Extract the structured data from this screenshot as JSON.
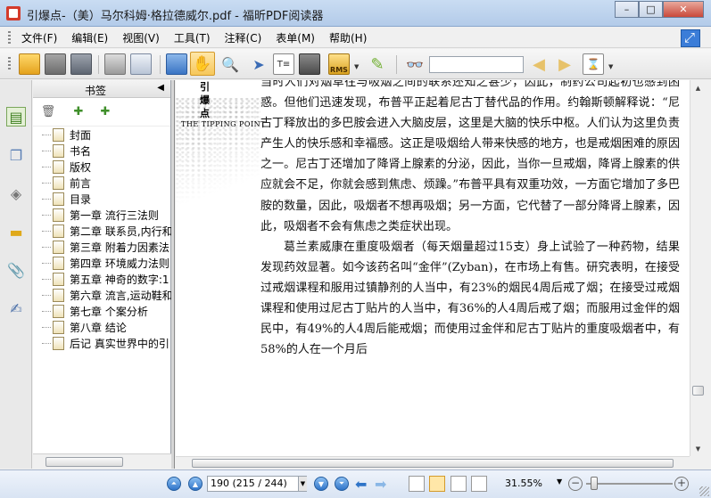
{
  "window": {
    "title": "引爆点-（美）马尔科姆·格拉德威尔.pdf - 福昕PDF阅读器",
    "minimize": "–",
    "maximize": "□",
    "close": "✕"
  },
  "menu": {
    "items": [
      "文件(F)",
      "编辑(E)",
      "视图(V)",
      "工具(T)",
      "注释(C)",
      "表单(M)",
      "帮助(H)"
    ]
  },
  "toolbar": {
    "search_value": "",
    "rms_label": "RMS"
  },
  "bookmarks": {
    "header": "书签",
    "items": [
      "封面",
      "书名",
      "版权",
      "前言",
      "目录",
      "第一章 流行三法则",
      "第二章 联系员,内行和",
      "第三章 附着力因素法",
      "第四章 环境威力法则",
      "第五章 神奇的数字:1",
      "第六章 流言,运动鞋和",
      "第七章 个案分析",
      "第八章 结论",
      "后记 真实世界中的引"
    ]
  },
  "page": {
    "deco_title_chars": [
      "引",
      "爆",
      "点"
    ],
    "deco_subtitle": "THE TIPPING POINT",
    "paragraph1": "当时人们对烟草往与吸烟之间的联系还知之甚少，因此，制药公司起初也感到困惑。但他们迅速发现，布普平正起着尼古丁替代品的作用。约翰斯顿解释说：“尼古丁释放出的多巴胺会进入大脑皮层，这里是大脑的快乐中枢。人们认为这里负责产生人的快乐感和幸福感。这正是吸烟给人带来快感的地方，也是戒烟困难的原因之一。尼古丁还增加了降肾上腺素的分泌，因此，当你一旦戒烟，降肾上腺素的供应就会不足，你就会感到焦虑、烦躁。”布普平具有双重功效，一方面它增加了多巴胺的数量，因此，吸烟者不想再吸烟；另一方面，它代替了一部分降肾上腺素，因此，吸烟者不会有焦虑之类症状出现。",
    "paragraph2": "葛兰素威康在重度吸烟者（每天烟量超过15支）身上试验了一种药物，结果发现药效显著。如今该药名叫“金伴”(Zyban)，在市场上有售。研究表明，在接受过戒烟课程和服用过镇静剂的人当中，有23%的烟民4周后戒了烟；在接受过戒烟课程和使用过尼古丁贴片的人当中，有36%的人4周后戒了烟；而服用过金伴的烟民中，有49%的人4周后能戒烟；而使用过金伴和尼古丁贴片的重度吸烟者中，有58%的人在一个月后"
  },
  "statusbar": {
    "page_display": "190 (215 / 244)",
    "zoom": "31.55%"
  }
}
